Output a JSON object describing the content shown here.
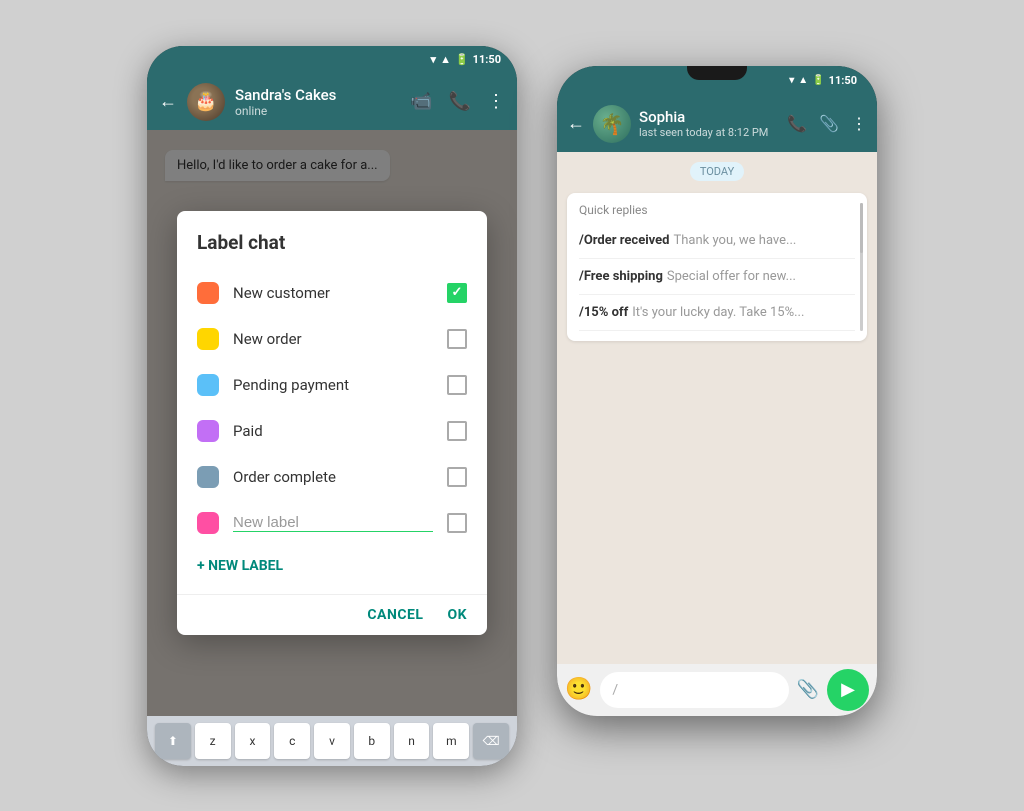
{
  "left_phone": {
    "status_bar": {
      "time": "11:50"
    },
    "header": {
      "contact_name": "Sandra's Cakes",
      "status": "online"
    },
    "chat_preview": "Hello, I'd like to order a cake for a...",
    "dialog": {
      "title": "Label chat",
      "labels": [
        {
          "id": "new-customer",
          "name": "New customer",
          "color": "#FF6D3A",
          "checked": true
        },
        {
          "id": "new-order",
          "name": "New order",
          "color": "#FFD600",
          "checked": false
        },
        {
          "id": "pending-payment",
          "name": "Pending payment",
          "color": "#5BC0F8",
          "checked": false
        },
        {
          "id": "paid",
          "name": "Paid",
          "color": "#C26FF5",
          "checked": false
        },
        {
          "id": "order-complete",
          "name": "Order complete",
          "color": "#7B9DB4",
          "checked": false
        }
      ],
      "new_label_placeholder": "New label",
      "new_label_color": "#FF4FA3",
      "new_label_btn": "+ NEW LABEL",
      "cancel_btn": "CANCEL",
      "ok_btn": "OK"
    },
    "keyboard": {
      "keys": [
        "z",
        "x",
        "c",
        "v",
        "b",
        "n",
        "m"
      ]
    }
  },
  "right_phone": {
    "status_bar": {
      "time": "11:50"
    },
    "header": {
      "contact_name": "Sophia",
      "last_seen": "last seen today at 8:12 PM"
    },
    "today_label": "TODAY",
    "quick_replies": {
      "title": "Quick replies",
      "items": [
        {
          "shortcut": "/Order received",
          "preview": "Thank you, we have..."
        },
        {
          "shortcut": "/Free shipping",
          "preview": "Special offer for new..."
        },
        {
          "shortcut": "/15% off",
          "preview": "It's your lucky day. Take 15%..."
        }
      ]
    },
    "input": {
      "slash": "/"
    }
  }
}
